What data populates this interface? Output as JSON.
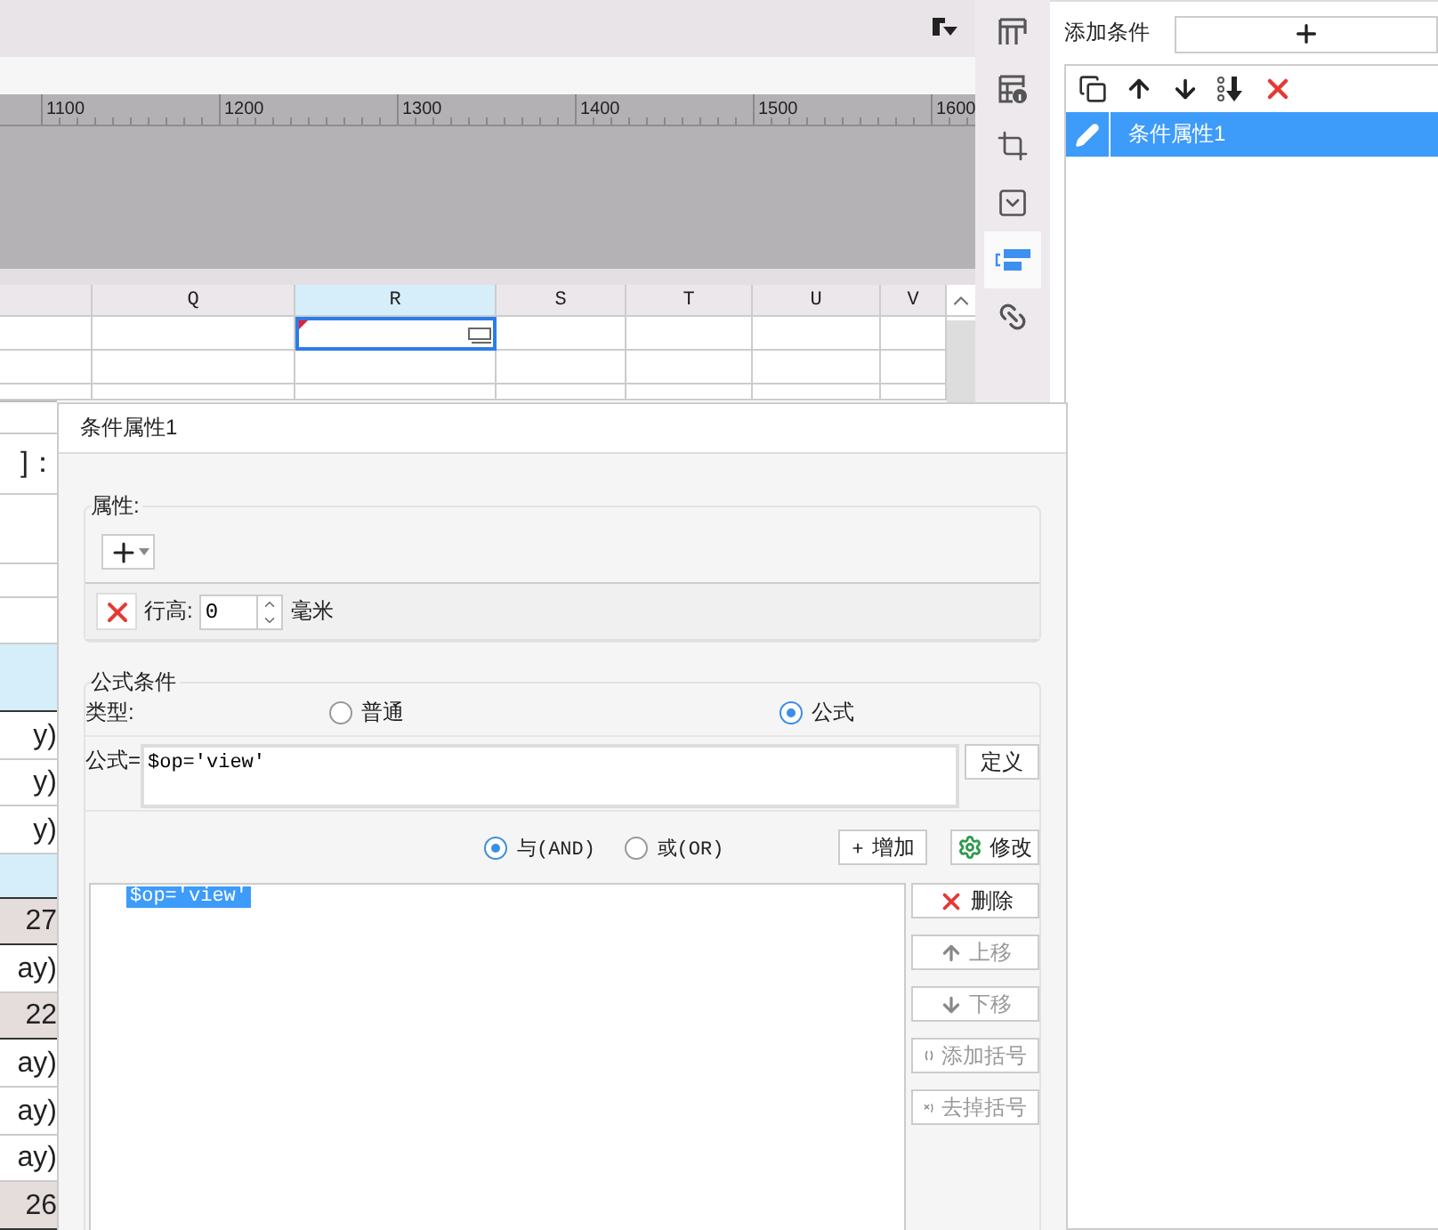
{
  "ruler": {
    "labels": [
      "1100",
      "1200",
      "1300",
      "1400",
      "1500",
      "1600"
    ]
  },
  "sheet": {
    "columns": [
      {
        "label": "Q",
        "selected": false
      },
      {
        "label": "R",
        "selected": true
      },
      {
        "label": "S",
        "selected": false
      },
      {
        "label": "T",
        "selected": false
      },
      {
        "label": "U",
        "selected": false
      },
      {
        "label": "V",
        "selected": false
      }
    ]
  },
  "left_cells": [
    {
      "kind": "plain"
    },
    {
      "kind": "plain",
      "text": "]："
    },
    {
      "kind": "plain"
    },
    {
      "kind": "plain"
    },
    {
      "kind": "plain"
    },
    {
      "kind": "band"
    },
    {
      "kind": "plain",
      "text": "y)"
    },
    {
      "kind": "plain",
      "text": "y)"
    },
    {
      "kind": "plain",
      "text": "y)"
    },
    {
      "kind": "band"
    },
    {
      "kind": "shade",
      "text": "27"
    },
    {
      "kind": "plain",
      "text": "ay)"
    },
    {
      "kind": "shade",
      "text": "22"
    },
    {
      "kind": "plain",
      "text": "ay)"
    },
    {
      "kind": "plain",
      "text": "ay)"
    },
    {
      "kind": "plain",
      "text": "ay)"
    },
    {
      "kind": "shade",
      "text": "26"
    }
  ],
  "tool_tabs": [
    {
      "kind": "grid",
      "selected": false
    },
    {
      "kind": "info",
      "selected": false
    },
    {
      "kind": "frame",
      "selected": false
    },
    {
      "kind": "dropdown",
      "selected": false
    },
    {
      "kind": "condition",
      "selected": true
    },
    {
      "kind": "link",
      "selected": false
    }
  ],
  "condition_panel": {
    "label": "添加条件",
    "conditions": [
      {
        "name": "条件属性1",
        "selected": true
      }
    ]
  },
  "dialog": {
    "title": "条件属性1",
    "properties": {
      "legend": "属性:",
      "rows": [
        {
          "label": "行高:",
          "value": "0",
          "unit": "毫米"
        }
      ]
    },
    "formula": {
      "legend": "公式条件",
      "type_label": "类型:",
      "types": [
        {
          "label": "普通",
          "selected": false
        },
        {
          "label": "公式",
          "selected": true
        }
      ],
      "formula_label": "公式=",
      "formula_value": "$op='view'",
      "define_button": "定义",
      "logic": [
        {
          "label": "与(AND)",
          "selected": true
        },
        {
          "label": "或(OR)",
          "selected": false
        }
      ],
      "add_button": "增加",
      "modify_button": "修改",
      "expressions": [
        {
          "text": "$op='view'",
          "selected": true
        }
      ],
      "actions": [
        {
          "kind": "delete",
          "label": "删除",
          "disabled": false
        },
        {
          "kind": "up",
          "label": "上移",
          "disabled": true
        },
        {
          "kind": "down",
          "label": "下移",
          "disabled": true
        },
        {
          "kind": "add_paren",
          "label": "添加括号",
          "disabled": true
        },
        {
          "kind": "remove_paren",
          "label": "去掉括号",
          "disabled": true
        }
      ]
    }
  }
}
